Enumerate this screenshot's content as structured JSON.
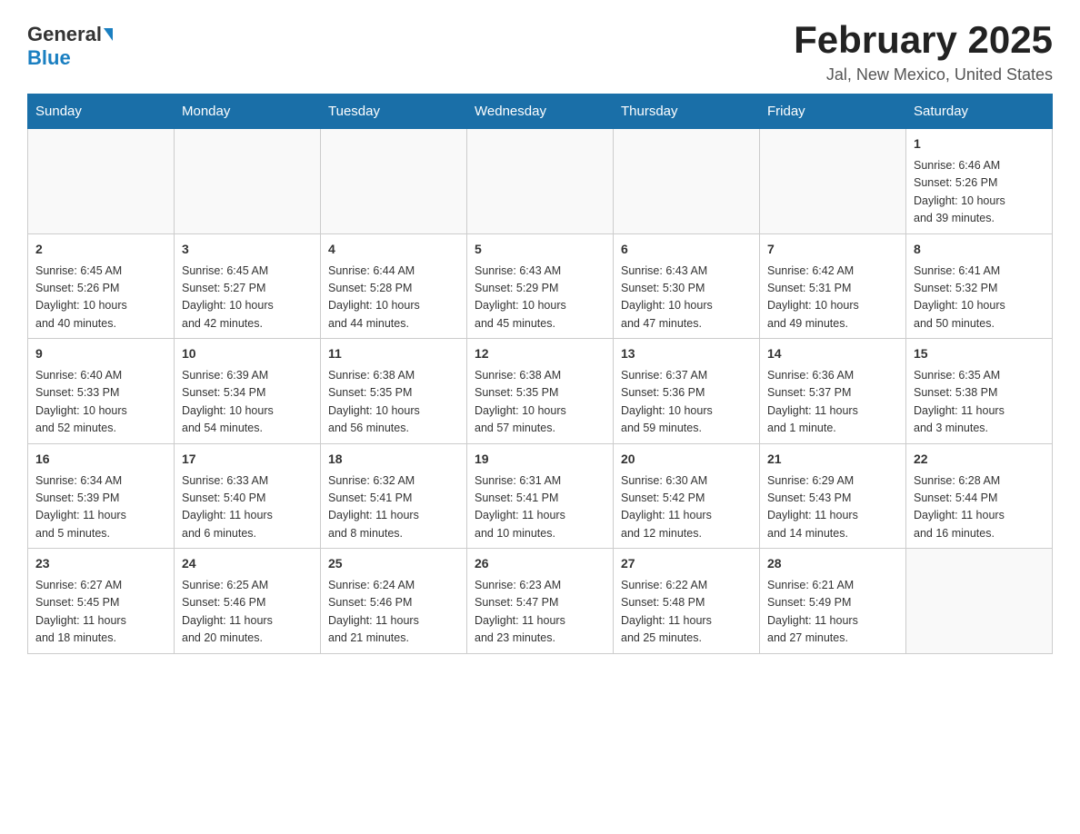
{
  "header": {
    "logo_text_general": "General",
    "logo_text_blue": "Blue",
    "title": "February 2025",
    "subtitle": "Jal, New Mexico, United States"
  },
  "days_of_week": [
    "Sunday",
    "Monday",
    "Tuesday",
    "Wednesday",
    "Thursday",
    "Friday",
    "Saturday"
  ],
  "weeks": [
    {
      "days": [
        {
          "number": "",
          "info": ""
        },
        {
          "number": "",
          "info": ""
        },
        {
          "number": "",
          "info": ""
        },
        {
          "number": "",
          "info": ""
        },
        {
          "number": "",
          "info": ""
        },
        {
          "number": "",
          "info": ""
        },
        {
          "number": "1",
          "info": "Sunrise: 6:46 AM\nSunset: 5:26 PM\nDaylight: 10 hours\nand 39 minutes."
        }
      ]
    },
    {
      "days": [
        {
          "number": "2",
          "info": "Sunrise: 6:45 AM\nSunset: 5:26 PM\nDaylight: 10 hours\nand 40 minutes."
        },
        {
          "number": "3",
          "info": "Sunrise: 6:45 AM\nSunset: 5:27 PM\nDaylight: 10 hours\nand 42 minutes."
        },
        {
          "number": "4",
          "info": "Sunrise: 6:44 AM\nSunset: 5:28 PM\nDaylight: 10 hours\nand 44 minutes."
        },
        {
          "number": "5",
          "info": "Sunrise: 6:43 AM\nSunset: 5:29 PM\nDaylight: 10 hours\nand 45 minutes."
        },
        {
          "number": "6",
          "info": "Sunrise: 6:43 AM\nSunset: 5:30 PM\nDaylight: 10 hours\nand 47 minutes."
        },
        {
          "number": "7",
          "info": "Sunrise: 6:42 AM\nSunset: 5:31 PM\nDaylight: 10 hours\nand 49 minutes."
        },
        {
          "number": "8",
          "info": "Sunrise: 6:41 AM\nSunset: 5:32 PM\nDaylight: 10 hours\nand 50 minutes."
        }
      ]
    },
    {
      "days": [
        {
          "number": "9",
          "info": "Sunrise: 6:40 AM\nSunset: 5:33 PM\nDaylight: 10 hours\nand 52 minutes."
        },
        {
          "number": "10",
          "info": "Sunrise: 6:39 AM\nSunset: 5:34 PM\nDaylight: 10 hours\nand 54 minutes."
        },
        {
          "number": "11",
          "info": "Sunrise: 6:38 AM\nSunset: 5:35 PM\nDaylight: 10 hours\nand 56 minutes."
        },
        {
          "number": "12",
          "info": "Sunrise: 6:38 AM\nSunset: 5:35 PM\nDaylight: 10 hours\nand 57 minutes."
        },
        {
          "number": "13",
          "info": "Sunrise: 6:37 AM\nSunset: 5:36 PM\nDaylight: 10 hours\nand 59 minutes."
        },
        {
          "number": "14",
          "info": "Sunrise: 6:36 AM\nSunset: 5:37 PM\nDaylight: 11 hours\nand 1 minute."
        },
        {
          "number": "15",
          "info": "Sunrise: 6:35 AM\nSunset: 5:38 PM\nDaylight: 11 hours\nand 3 minutes."
        }
      ]
    },
    {
      "days": [
        {
          "number": "16",
          "info": "Sunrise: 6:34 AM\nSunset: 5:39 PM\nDaylight: 11 hours\nand 5 minutes."
        },
        {
          "number": "17",
          "info": "Sunrise: 6:33 AM\nSunset: 5:40 PM\nDaylight: 11 hours\nand 6 minutes."
        },
        {
          "number": "18",
          "info": "Sunrise: 6:32 AM\nSunset: 5:41 PM\nDaylight: 11 hours\nand 8 minutes."
        },
        {
          "number": "19",
          "info": "Sunrise: 6:31 AM\nSunset: 5:41 PM\nDaylight: 11 hours\nand 10 minutes."
        },
        {
          "number": "20",
          "info": "Sunrise: 6:30 AM\nSunset: 5:42 PM\nDaylight: 11 hours\nand 12 minutes."
        },
        {
          "number": "21",
          "info": "Sunrise: 6:29 AM\nSunset: 5:43 PM\nDaylight: 11 hours\nand 14 minutes."
        },
        {
          "number": "22",
          "info": "Sunrise: 6:28 AM\nSunset: 5:44 PM\nDaylight: 11 hours\nand 16 minutes."
        }
      ]
    },
    {
      "days": [
        {
          "number": "23",
          "info": "Sunrise: 6:27 AM\nSunset: 5:45 PM\nDaylight: 11 hours\nand 18 minutes."
        },
        {
          "number": "24",
          "info": "Sunrise: 6:25 AM\nSunset: 5:46 PM\nDaylight: 11 hours\nand 20 minutes."
        },
        {
          "number": "25",
          "info": "Sunrise: 6:24 AM\nSunset: 5:46 PM\nDaylight: 11 hours\nand 21 minutes."
        },
        {
          "number": "26",
          "info": "Sunrise: 6:23 AM\nSunset: 5:47 PM\nDaylight: 11 hours\nand 23 minutes."
        },
        {
          "number": "27",
          "info": "Sunrise: 6:22 AM\nSunset: 5:48 PM\nDaylight: 11 hours\nand 25 minutes."
        },
        {
          "number": "28",
          "info": "Sunrise: 6:21 AM\nSunset: 5:49 PM\nDaylight: 11 hours\nand 27 minutes."
        },
        {
          "number": "",
          "info": ""
        }
      ]
    }
  ]
}
